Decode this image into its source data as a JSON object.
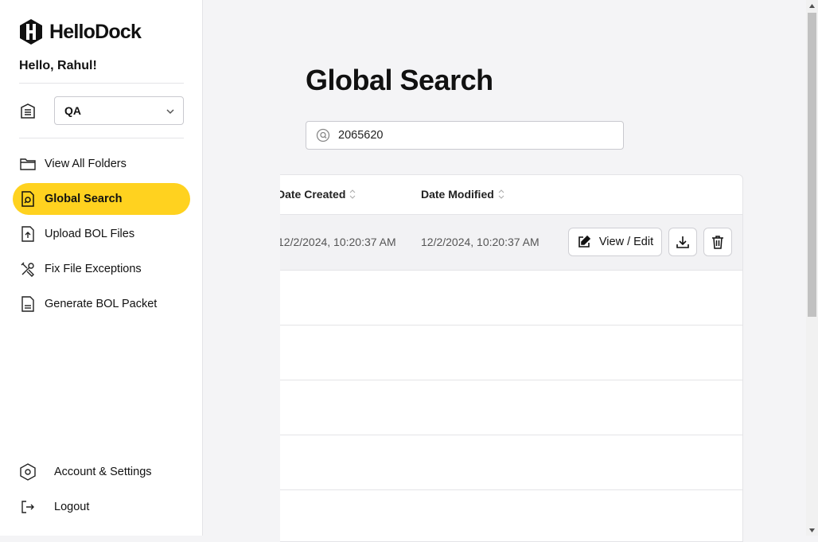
{
  "brand": {
    "name": "HelloDock"
  },
  "sidebar": {
    "greeting": "Hello, Rahul!",
    "workspace": {
      "selected": "QA",
      "icon": "building-icon"
    },
    "nav": [
      {
        "label": "View All Folders",
        "icon": "folder-icon",
        "active": false
      },
      {
        "label": "Global Search",
        "icon": "file-search-icon",
        "active": true
      },
      {
        "label": "Upload BOL Files",
        "icon": "file-upload-icon",
        "active": false
      },
      {
        "label": "Fix File Exceptions",
        "icon": "tools-icon",
        "active": false
      },
      {
        "label": "Generate BOL Packet",
        "icon": "document-icon",
        "active": false
      }
    ],
    "bottom": [
      {
        "label": "Account & Settings",
        "icon": "settings-hex-icon"
      },
      {
        "label": "Logout",
        "icon": "logout-icon"
      }
    ]
  },
  "main": {
    "title": "Global Search",
    "search": {
      "value": "2065620",
      "icon": "search-icon"
    },
    "table": {
      "columns": [
        "Date Created",
        "Date Modified"
      ],
      "rows": [
        {
          "date_created": "12/2/2024, 10:20:37 AM",
          "date_modified": "12/2/2024, 10:20:37 AM",
          "actions": {
            "view_edit": "View / Edit",
            "download_icon": "download-icon",
            "delete_icon": "trash-icon"
          }
        }
      ]
    }
  },
  "colors": {
    "accent": "#ffd21f",
    "background": "#f4f4f6",
    "border": "#e4e4e7"
  }
}
